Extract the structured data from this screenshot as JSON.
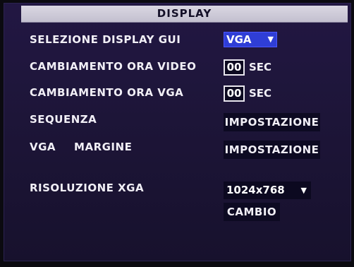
{
  "header": {
    "title": "DISPLAY"
  },
  "rows": {
    "gui_display": {
      "label": "SELEZIONE DISPLAY GUI",
      "value": "VGA"
    },
    "video_time_change": {
      "label": "CAMBIAMENTO ORA VIDEO",
      "value": "00",
      "unit": "SEC"
    },
    "vga_time_change": {
      "label": "CAMBIAMENTO ORA VGA",
      "value": "00",
      "unit": "SEC"
    },
    "sequence": {
      "label": "SEQUENZA",
      "button": "IMPOSTAZIONE"
    },
    "vga_margin": {
      "label_a": "VGA",
      "label_b": "MARGINE",
      "button": "IMPOSTAZIONE"
    },
    "resolution": {
      "label": "RISOLUZIONE XGA",
      "value": "1024x768",
      "button": "CAMBIO"
    }
  },
  "icons": {
    "dropdown": "chevron-down-icon"
  },
  "colors": {
    "background": "#1d1538",
    "title_bar": "#cfccd9",
    "selected_highlight": "#2f3ed6",
    "text": "#f1eff6"
  }
}
